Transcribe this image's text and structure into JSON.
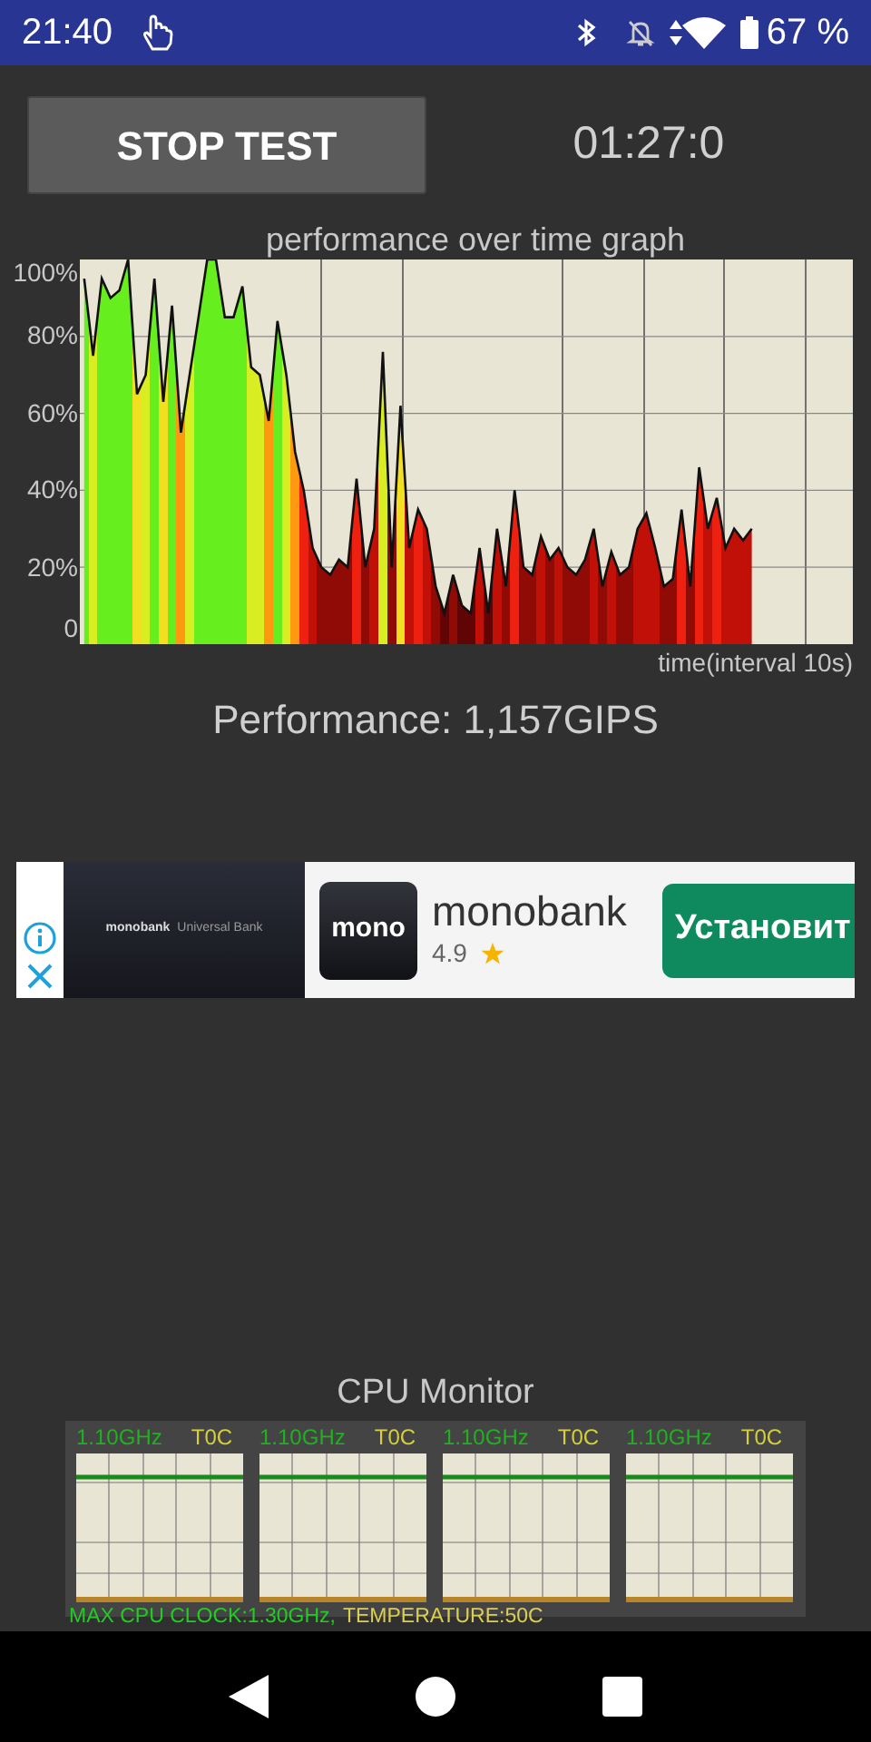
{
  "status_bar": {
    "time": "21:40",
    "battery": "67 %"
  },
  "test": {
    "button": "STOP TEST",
    "timer": "01:27:0"
  },
  "graph": {
    "title": "performance over time graph",
    "chart_data": {
      "type": "area",
      "xlabel": "time(interval 10s)",
      "ylim": [
        0,
        100
      ],
      "yticks": [
        0,
        {
          "value": 20,
          "label": "20%"
        },
        {
          "value": 40,
          "label": "40%"
        },
        {
          "value": 60,
          "label": "60%"
        },
        {
          "value": 80,
          "label": "80%"
        },
        {
          "value": 100,
          "label": "100%"
        }
      ],
      "grid": true,
      "values": [
        95,
        75,
        95,
        90,
        92,
        100,
        65,
        70,
        95,
        63,
        88,
        55,
        70,
        85,
        100,
        100,
        85,
        85,
        93,
        72,
        70,
        58,
        84,
        70,
        50,
        40,
        25,
        20,
        18,
        22,
        20,
        43,
        20,
        30,
        76,
        20,
        62,
        25,
        35,
        30,
        15,
        8,
        18,
        10,
        8,
        25,
        8,
        30,
        15,
        40,
        20,
        18,
        28,
        22,
        25,
        20,
        18,
        22,
        30,
        15,
        24,
        18,
        20,
        30,
        34,
        25,
        15,
        17,
        35,
        15,
        46,
        30,
        38,
        25,
        30,
        27,
        30,
        null,
        null,
        null,
        null,
        null,
        null,
        null,
        null,
        null,
        null,
        null
      ]
    }
  },
  "performance": "Performance: 1,157GIPS",
  "ad": {
    "banner_text": "monobank",
    "banner_subtext": "Universal Bank",
    "app_icon_text": "mono",
    "app_name": "monobank",
    "rating": "4.9",
    "button": "Установит"
  },
  "cpu_monitor": {
    "title": "CPU Monitor",
    "cores": [
      {
        "clock": "1.10GHz",
        "temp": "T0C"
      },
      {
        "clock": "1.10GHz",
        "temp": "T0C"
      },
      {
        "clock": "1.10GHz",
        "temp": "T0C"
      },
      {
        "clock": "1.10GHz",
        "temp": "T0C"
      }
    ],
    "max_clock": "MAX CPU CLOCK:1.30GHz,",
    "temperature": "TEMPERATURE:50C"
  }
}
